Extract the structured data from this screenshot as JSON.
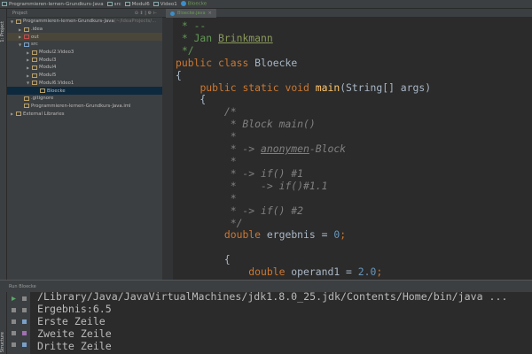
{
  "breadcrumb": [
    "Programmieren-lernen-Grundkurs-Java",
    "src",
    "Modul6",
    "Video1",
    "Bloecke"
  ],
  "side_tab": "1: Project",
  "project_panel": {
    "title": "Project",
    "tree": [
      {
        "label": "Programmieren-lernen-Grundkurs-Java",
        "suffix": "(~/IdeaProjects/...",
        "depth": 0,
        "open": true
      },
      {
        "label": ".idea",
        "depth": 1
      },
      {
        "label": "out",
        "depth": 1
      },
      {
        "label": "src",
        "depth": 1,
        "open": true
      },
      {
        "label": "Modul2.Video3",
        "depth": 2
      },
      {
        "label": "Modul3",
        "depth": 2
      },
      {
        "label": "Modul4",
        "depth": 2
      },
      {
        "label": "Modul5",
        "depth": 2
      },
      {
        "label": "Modul6.Video1",
        "depth": 2,
        "open": true
      },
      {
        "label": "Bloecke",
        "depth": 3,
        "selected": true
      },
      {
        "label": ".gitignore",
        "depth": 1
      },
      {
        "label": "Programmieren-lernen-Grundkurs-Java.iml",
        "depth": 1
      },
      {
        "label": "External Libraries",
        "depth": 0
      }
    ]
  },
  "editor": {
    "tab": "Bloecke.java",
    "lines": [
      " * --",
      " * Jan Brinkmann",
      " */",
      "public class Bloecke",
      "{",
      "    public static void main(String[] args)",
      "    {",
      "        /*",
      "         * Block main()",
      "         *",
      "         * -> anonymen-Block",
      "         *",
      "         * -> if() #1",
      "         *    -> if()#1.1",
      "         *",
      "         * -> if() #2",
      "         */",
      "        double ergebnis = 0;",
      "",
      "        {",
      "            double operand1 = 2.0;"
    ]
  },
  "run": {
    "label": "Run",
    "config": "Bloecke",
    "structure_tab": "Structure",
    "output": [
      "/Library/Java/JavaVirtualMachines/jdk1.8.0_25.jdk/Contents/Home/bin/java ...",
      "Ergebnis:6.5",
      "Erste Zeile",
      "Zweite Zeile",
      "Dritte Zeile"
    ]
  }
}
